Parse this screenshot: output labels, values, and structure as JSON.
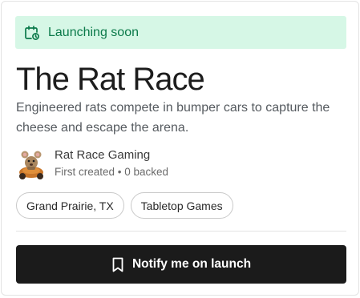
{
  "banner": {
    "icon": "calendar-clock-icon",
    "text": "Launching soon",
    "color": "#0b7a4a",
    "background": "#d6f7e6"
  },
  "project": {
    "title": "The Rat Race",
    "description": "Engineered rats compete in bumper cars to capture the cheese and escape the arena."
  },
  "creator": {
    "name": "Rat Race Gaming",
    "meta": "First created • 0 backed",
    "avatar_icon": "rat-in-car-avatar"
  },
  "tags": [
    "Grand Prairie, TX",
    "Tabletop Games"
  ],
  "cta": {
    "label": "Notify me on launch",
    "icon": "bookmark-icon",
    "background": "#1b1b1b"
  }
}
